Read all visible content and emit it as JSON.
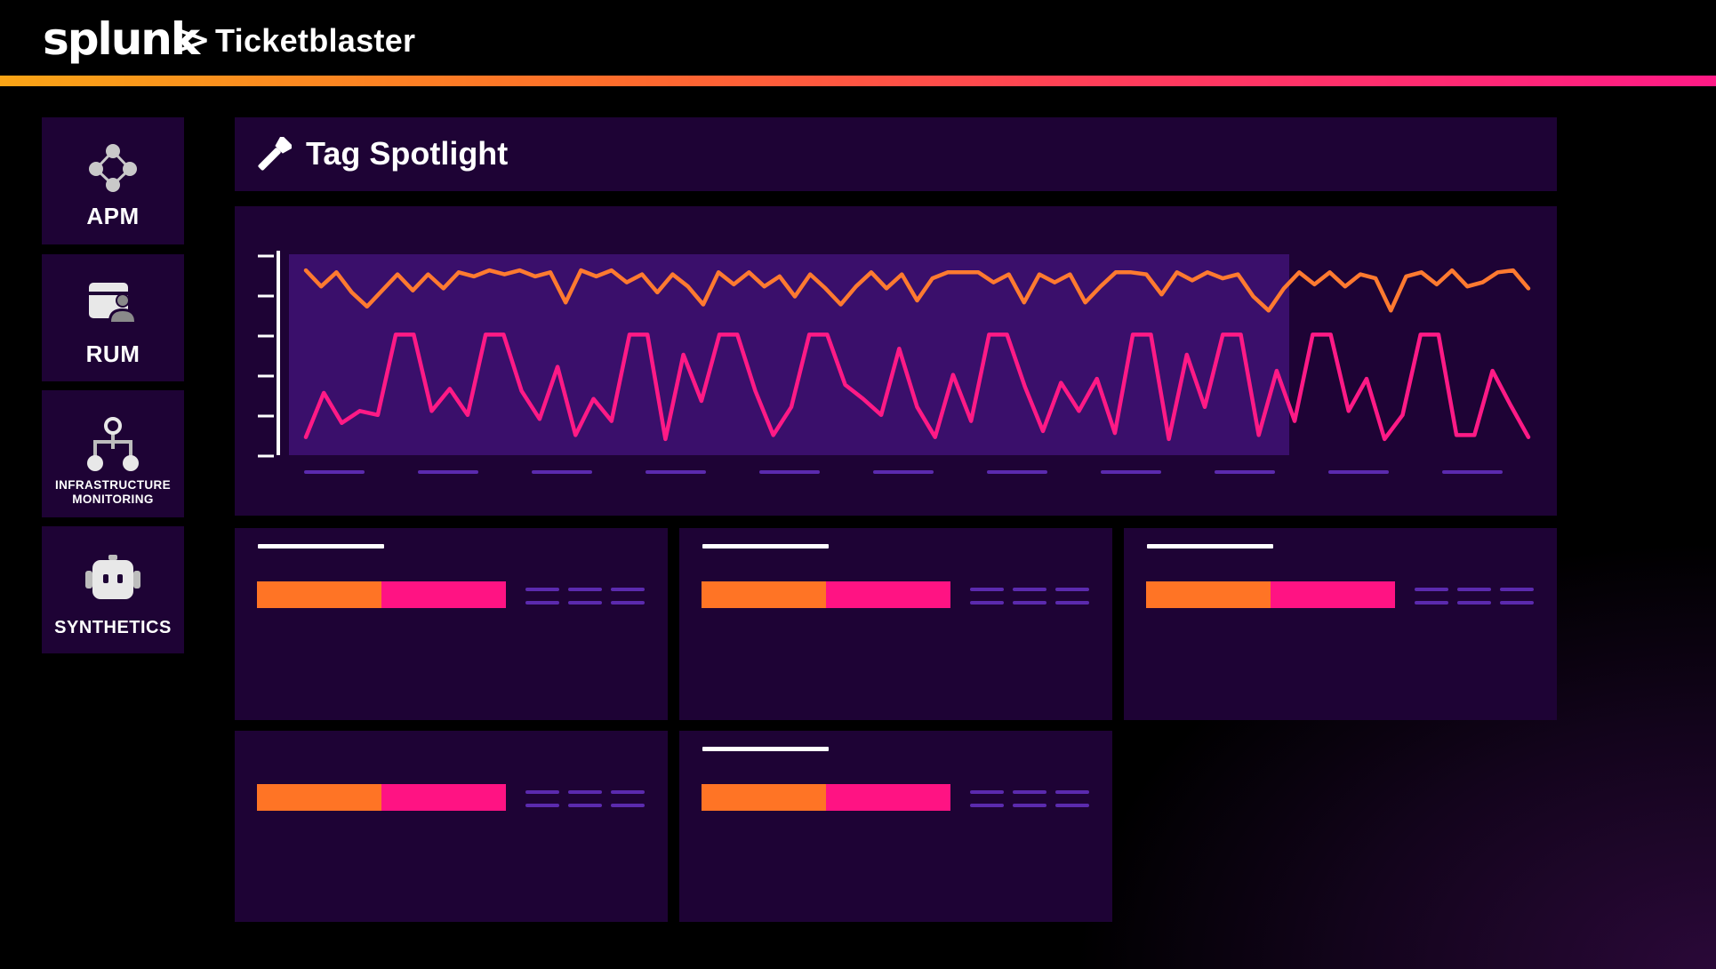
{
  "app": {
    "logo_text": "splunk",
    "logo_chevron": ">",
    "title": "Ticketblaster"
  },
  "colors": {
    "background": "#000000",
    "panel": "#1e0335",
    "chart_plot_bg": "#3a0f6b",
    "series_orange": "#ff7a30",
    "series_pink": "#ff1a86",
    "bar_orange": "#ff7425",
    "bar_pink": "#ff1383",
    "placeholder_dash": "#5b2aae"
  },
  "sidebar": {
    "items": [
      {
        "label": "APM",
        "icon": "apm-nodes-icon"
      },
      {
        "label": "RUM",
        "icon": "rum-browser-user-icon"
      },
      {
        "label_line1": "INFRASTRUCTURE",
        "label_line2": "MONITORING",
        "icon": "infrastructure-hierarchy-icon"
      },
      {
        "label": "SYNTHETICS",
        "icon": "robot-icon"
      }
    ]
  },
  "spotlight": {
    "title": "Tag Spotlight",
    "icon": "flashlight-icon"
  },
  "chart_data": {
    "type": "line",
    "title": "",
    "xlabel": "",
    "ylabel": "",
    "ylim": [
      0,
      100
    ],
    "grid": false,
    "legend": "none",
    "y_ticks": 6,
    "x_ticks": 11,
    "series": [
      {
        "color": "#ff7a30",
        "x": [
          0,
          1,
          2,
          3,
          4,
          5,
          6,
          7,
          8,
          9,
          10,
          11,
          12,
          13,
          14,
          15,
          16,
          17,
          18,
          19,
          20,
          21,
          22,
          23,
          24,
          25,
          26,
          27,
          28,
          29,
          30,
          31,
          32,
          33,
          34,
          35,
          36,
          37,
          38,
          39,
          40,
          41,
          42,
          43,
          44,
          45,
          46,
          47,
          48,
          49,
          50,
          51,
          52,
          53,
          54,
          55,
          56,
          57,
          58,
          59,
          60,
          61,
          62,
          63,
          64,
          65,
          66,
          67,
          68,
          69,
          70,
          71,
          72,
          73,
          74,
          75,
          76,
          77,
          78,
          79,
          80
        ],
        "values": [
          92,
          84,
          91,
          81,
          74,
          82,
          90,
          82,
          90,
          83,
          91,
          89,
          92,
          90,
          92,
          89,
          91,
          76,
          92,
          89,
          92,
          86,
          90,
          81,
          90,
          84,
          75,
          91,
          85,
          91,
          84,
          89,
          79,
          90,
          83,
          75,
          84,
          91,
          83,
          90,
          77,
          88,
          91,
          91,
          91,
          86,
          90,
          76,
          90,
          86,
          90,
          76,
          84,
          91,
          91,
          90,
          80,
          91,
          87,
          91,
          88,
          90,
          79,
          72,
          83,
          91,
          85,
          91,
          84,
          90,
          88,
          72,
          89,
          91,
          85,
          92,
          84,
          86,
          91,
          92,
          83
        ],
        "values_note_ignore": ""
      },
      {
        "color": "#ff1a86",
        "x": [
          0,
          1,
          2,
          3,
          4,
          5,
          6,
          7,
          8,
          9,
          10,
          11,
          12,
          13,
          14,
          15,
          16,
          17,
          18,
          19,
          20,
          21,
          22,
          23,
          24,
          25,
          26,
          27,
          28,
          29,
          30,
          31,
          32,
          33,
          34,
          35,
          36,
          37,
          38,
          39,
          40,
          41,
          42,
          43,
          44,
          45,
          46,
          47,
          48,
          49,
          50,
          51,
          52,
          53,
          54,
          55,
          56,
          57,
          58,
          59,
          60,
          61,
          62,
          63,
          64,
          65,
          66,
          67,
          68,
          69,
          70,
          71,
          72,
          73,
          74,
          75,
          76,
          77,
          78,
          79,
          80
        ],
        "values": [
          9,
          31,
          16,
          22,
          20,
          60,
          60,
          22,
          33,
          20,
          60,
          60,
          32,
          18,
          44,
          10,
          28,
          17,
          60,
          60,
          8,
          50,
          27,
          60,
          60,
          32,
          10,
          24,
          60,
          60,
          35,
          28,
          20,
          53,
          24,
          9,
          40,
          17,
          60,
          60,
          34,
          12,
          36,
          22,
          38,
          11,
          60,
          60,
          8,
          50,
          24,
          60,
          60,
          10,
          42,
          17,
          60,
          60,
          22,
          38,
          8,
          20,
          60,
          60,
          10,
          10,
          42,
          25,
          9,
          0,
          0,
          0,
          0,
          0,
          0,
          0,
          0,
          0,
          0,
          0,
          0
        ]
      }
    ]
  },
  "cards": [
    {
      "has_title": true
    },
    {
      "has_title": true
    },
    {
      "has_title": true
    },
    {
      "has_title": false
    },
    {
      "has_title": true
    }
  ]
}
